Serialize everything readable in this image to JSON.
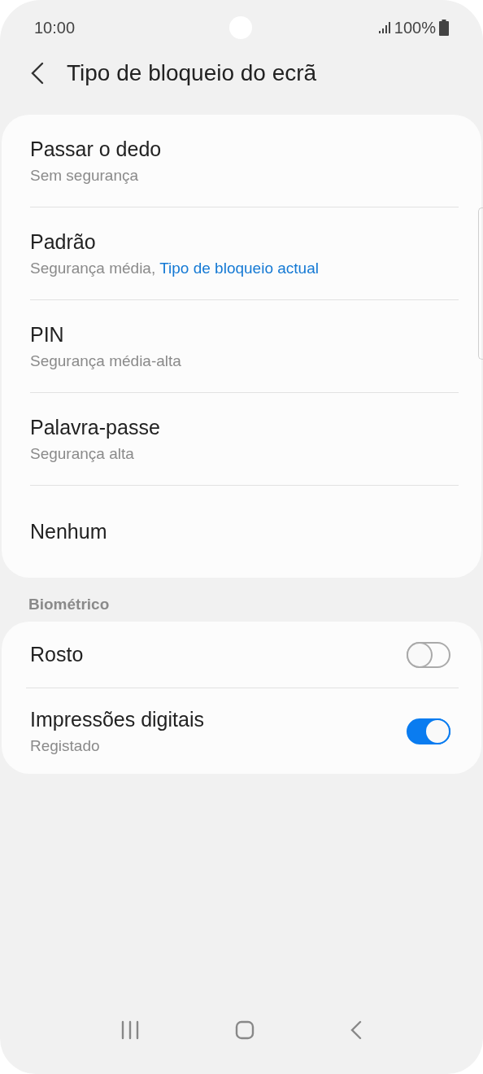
{
  "status_bar": {
    "time": "10:00",
    "battery": "100%"
  },
  "header": {
    "title": "Tipo de bloqueio do ecrã"
  },
  "lock_types": [
    {
      "title": "Passar o dedo",
      "subtitle": "Sem segurança"
    },
    {
      "title": "Padrão",
      "subtitle": "Segurança média,",
      "note": "Tipo de bloqueio actual"
    },
    {
      "title": "PIN",
      "subtitle": "Segurança média-alta"
    },
    {
      "title": "Palavra-passe",
      "subtitle": "Segurança alta"
    },
    {
      "title": "Nenhum"
    }
  ],
  "biometric": {
    "heading": "Biométrico",
    "items": [
      {
        "title": "Rosto",
        "on": false
      },
      {
        "title": "Impressões digitais",
        "subtitle": "Registado",
        "on": true
      }
    ]
  }
}
